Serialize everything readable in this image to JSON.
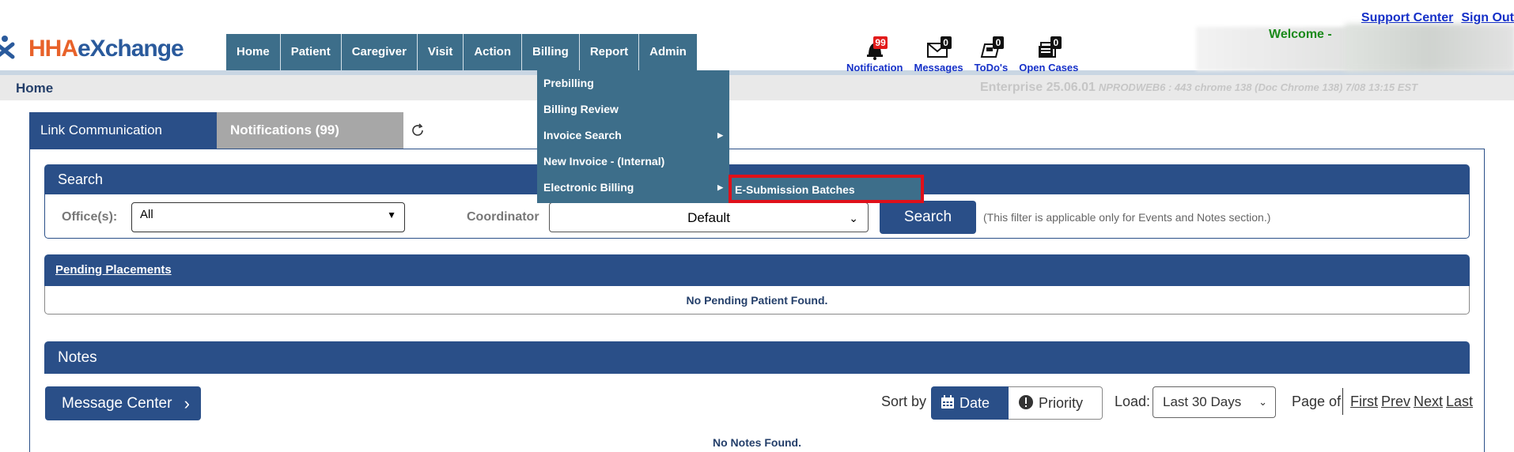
{
  "header": {
    "logo": {
      "hha": "HHA",
      "exchange": "eXchange"
    },
    "nav": [
      "Home",
      "Patient",
      "Caregiver",
      "Visit",
      "Action",
      "Billing",
      "Report",
      "Admin"
    ],
    "icons": [
      {
        "name": "bell-icon",
        "label": "Notification",
        "badge": "99"
      },
      {
        "name": "envelope-icon",
        "label": "Messages",
        "badge": "0"
      },
      {
        "name": "todo-icon",
        "label": "ToDo's",
        "badge": "0"
      },
      {
        "name": "cases-icon",
        "label": "Open Cases",
        "badge": "0"
      }
    ],
    "support_link": "Support Center",
    "signout_link": "Sign Out",
    "welcome": "Welcome -"
  },
  "subbar": {
    "title": "Home",
    "env": "Enterprise 25.06.01",
    "build": "NPRODWEB6 : 443 chrome 138 (Doc Chrome 138) 7/08 13:15 EST"
  },
  "tabs": [
    "Link Communication",
    "Notifications (99)"
  ],
  "search": {
    "title": "Search",
    "office_label": "Office(s):",
    "office_value": "All",
    "coordinator_label": "Coordinator",
    "coordinator_value": "Default",
    "button": "Search",
    "note": "(This filter is applicable only for Events and Notes section.)"
  },
  "pending": {
    "title": "Pending Placements",
    "empty": "No Pending Patient Found."
  },
  "notes": {
    "title": "Notes",
    "message_center": "Message Center",
    "sort_label": "Sort by",
    "sort_date": "Date",
    "sort_priority": "Priority",
    "load_label": "Load:",
    "load_value": "Last 30 Days",
    "page_of": "Page of",
    "pager": [
      "First",
      "Prev",
      "Next",
      "Last"
    ],
    "empty": "No Notes Found."
  },
  "billing_menu": {
    "items": [
      "Prebilling",
      "Billing Review",
      "Invoice Search",
      "New Invoice - (Internal)",
      "Electronic Billing"
    ],
    "submenu_item": "E-Submission Batches"
  },
  "colors": {
    "navy": "#2a4f88",
    "menu": "#3d6e8a",
    "highlight": "#e0101a",
    "link": "#1530c8"
  }
}
